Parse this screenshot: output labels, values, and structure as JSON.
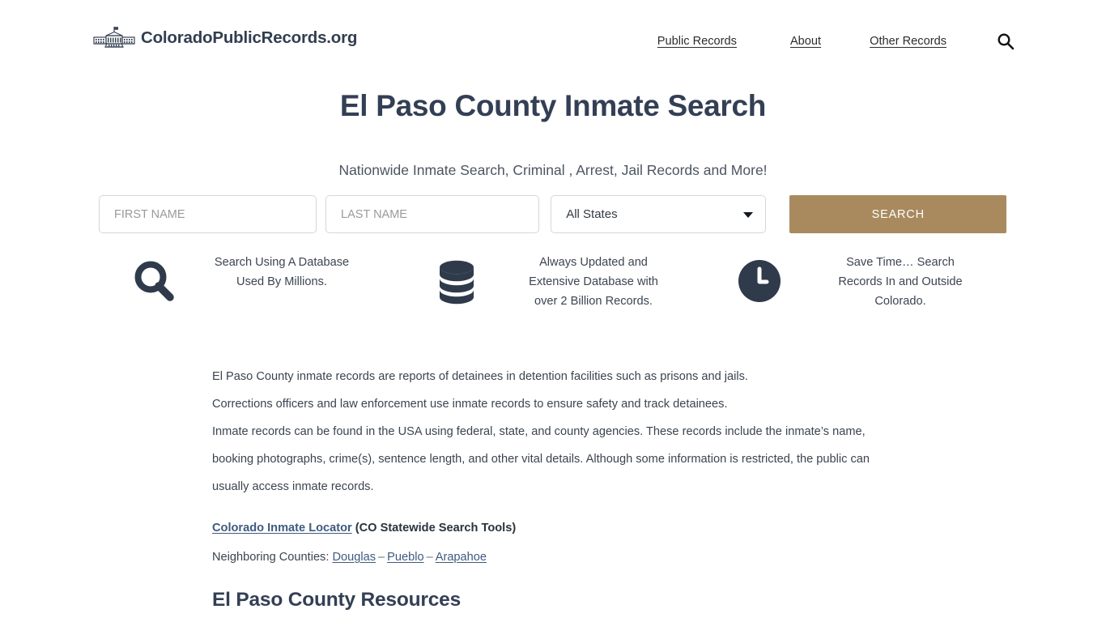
{
  "header": {
    "brand_name": "ColoradoPublicRecords.org",
    "brand_icon": "capitol-building-icon",
    "nav": [
      {
        "label": "Public Records"
      },
      {
        "label": "About"
      },
      {
        "label": "Other Records"
      }
    ],
    "search_icon": "search-icon"
  },
  "hero": {
    "title": "El Paso County Inmate Search",
    "subtitle": "Nationwide Inmate Search, Criminal , Arrest, Jail Records and More!"
  },
  "search_form": {
    "first_name_placeholder": "FIRST NAME",
    "first_name_value": "",
    "last_name_placeholder": "LAST NAME",
    "last_name_value": "",
    "state_selected": "All States",
    "state_options": [
      "All States"
    ],
    "submit_label": "SEARCH",
    "submit_color": "#a98a5f"
  },
  "features": [
    {
      "icon": "magnifier-icon",
      "line1": "Search Using A Database",
      "line2": "Used By Millions.",
      "line3": ""
    },
    {
      "icon": "database-icon",
      "line1": "Always Updated and",
      "line2": "Extensive Database with",
      "line3": "over 2 Billion Records."
    },
    {
      "icon": "clock-icon",
      "line1": "Save Time… Search",
      "line2": "Records In and Outside",
      "line3": "Colorado."
    }
  ],
  "article": {
    "p1": "El Paso County inmate records are reports of detainees in detention facilities such as prisons and jails.",
    "p2": "Corrections officers and law enforcement use inmate records to ensure safety and track detainees.",
    "p3": "Inmate records can be found in the USA using federal, state, and county agencies. These records include the inmate’s name, booking photographs, crime(s), sentence length, and other vital details. Although some information is restricted, the public can usually access inmate records.",
    "locator_link": "Colorado Inmate Locator",
    "locator_suffix": "(CO Statewide Search Tools)",
    "neighbors_label": "Neighboring Counties:",
    "neighbors": [
      "Douglas",
      "Pueblo",
      "Arapahoe"
    ],
    "neighbors_separator": "–"
  },
  "resources": {
    "heading": "El Paso County Resources"
  },
  "colors": {
    "heading": "#333f54",
    "body_text": "#3b4450",
    "link": "#3e5a7e",
    "accent_button": "#a98a5f",
    "icon_dark": "#2f3a4b",
    "background": "#ffffff"
  }
}
